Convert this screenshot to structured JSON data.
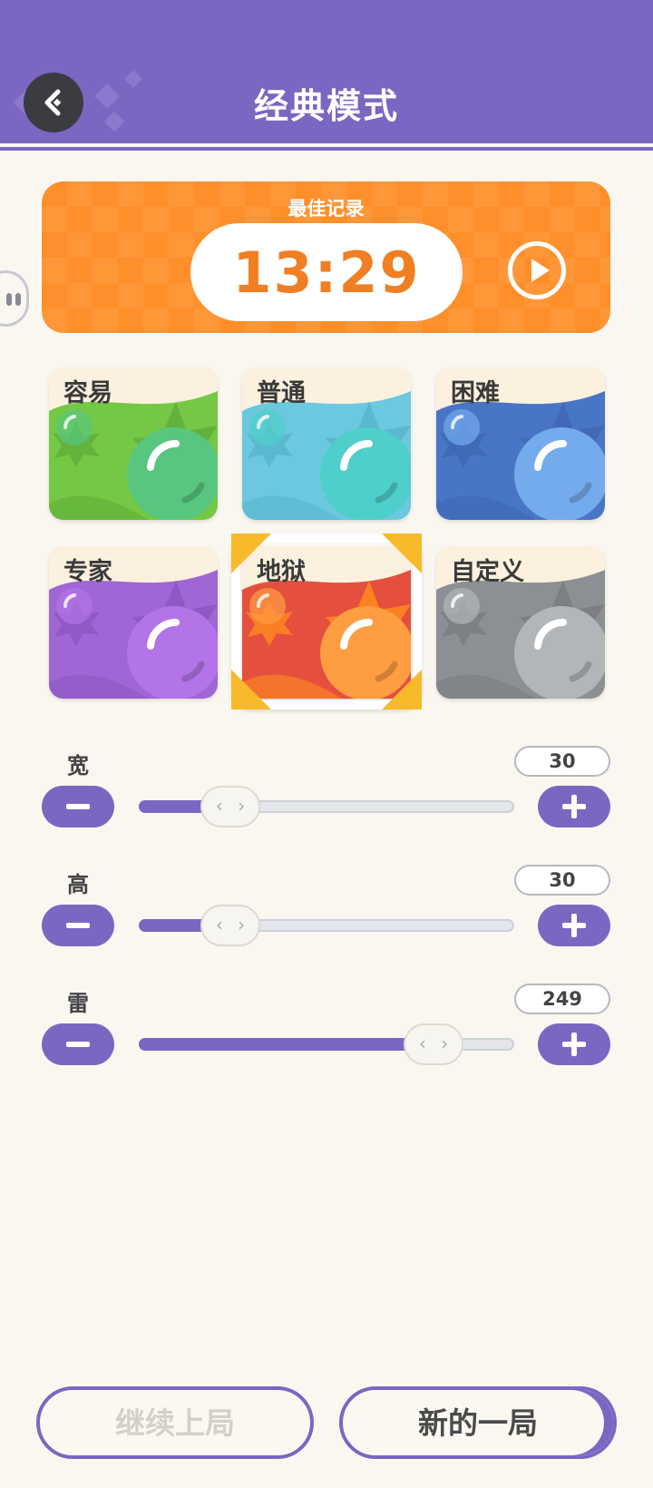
{
  "header": {
    "title": "经典模式"
  },
  "record": {
    "label": "最佳记录",
    "time": "13:29"
  },
  "difficulties": [
    {
      "label": "容易",
      "bg": "#75C845",
      "ball": "#58C67E",
      "accent": "#5FAE3A",
      "selected": false
    },
    {
      "label": "普通",
      "bg": "#6CC8DE",
      "ball": "#4ECFCB",
      "accent": "#58B5CB",
      "selected": false
    },
    {
      "label": "困难",
      "bg": "#4975C5",
      "ball": "#74ABEC",
      "accent": "#3F67B2",
      "selected": false
    },
    {
      "label": "专家",
      "bg": "#A066D6",
      "ball": "#B274E6",
      "accent": "#8D56C2",
      "selected": false
    },
    {
      "label": "地狱",
      "bg": "#E5503E",
      "ball": "#FF9D42",
      "accent": "#FF8A1F",
      "selected": true
    },
    {
      "label": "自定义",
      "bg": "#8C9094",
      "ball": "#B3B6B8",
      "accent": "#7A7D80",
      "selected": false
    }
  ],
  "sliders": [
    {
      "label": "宽",
      "value": "30",
      "fraction": 0.24,
      "thumb_glyph": "‹ ›"
    },
    {
      "label": "高",
      "value": "30",
      "fraction": 0.24,
      "thumb_glyph": "‹ ›"
    },
    {
      "label": "雷",
      "value": "249",
      "fraction": 0.78,
      "thumb_glyph": "‹ ›"
    }
  ],
  "actions": {
    "continue_label": "继续上局",
    "new_label": "新的一局"
  },
  "colors": {
    "primary": "#7B66C1",
    "record": "#FF8F2A",
    "background": "#FAF7F1",
    "selected_corner": "#F8B92A"
  }
}
